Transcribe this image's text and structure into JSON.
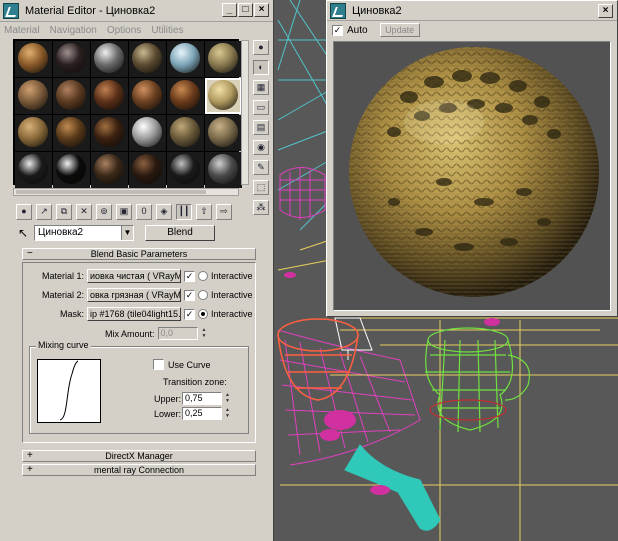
{
  "material_editor": {
    "title": "Material Editor - Циновка2",
    "menu": [
      "Material",
      "Navigation",
      "Options",
      "Utilities"
    ],
    "slots": [
      {
        "color": "#8a5a2a",
        "hi": "#e0b070"
      },
      {
        "color": "#2a2020",
        "hi": "#a09090"
      },
      {
        "color": "#6a6a6a",
        "hi": "#f0f0f0"
      },
      {
        "color": "#5a4a30",
        "hi": "#c8b890"
      },
      {
        "color": "#7ea6b8",
        "hi": "#e8f4fa"
      },
      {
        "color": "#8a7a50",
        "hi": "#d8c890"
      },
      {
        "color": "#7a5a3a",
        "hi": "#d0a070"
      },
      {
        "color": "#5a3a20",
        "hi": "#b08060"
      },
      {
        "color": "#5a3018",
        "hi": "#c08050"
      },
      {
        "color": "#6a4020",
        "hi": "#d09060"
      },
      {
        "color": "#6a3a1a",
        "hi": "#c88a50"
      },
      {
        "color": "#b09a60",
        "hi": "#f0e0a8"
      },
      {
        "color": "#8a6a3a",
        "hi": "#d8b078"
      },
      {
        "color": "#5a3a1a",
        "hi": "#c08a50"
      },
      {
        "color": "#3a2010",
        "hi": "#a07040"
      },
      {
        "color": "#9a9a9a",
        "hi": "#ffffff"
      },
      {
        "color": "#6a5a3a",
        "hi": "#c0a878"
      },
      {
        "color": "#7a6a4a",
        "hi": "#c8b088"
      },
      {
        "color": "#1a1a1a",
        "hi": "#e8e8e8"
      },
      {
        "color": "#0a0a0a",
        "hi": "#f0f0f0"
      },
      {
        "color": "#3a2818",
        "hi": "#a88060"
      },
      {
        "color": "#2a1a10",
        "hi": "#8a6040"
      },
      {
        "color": "#1a1a1a",
        "hi": "#c0c0c0"
      },
      {
        "color": "#4a4a4a",
        "hi": "#d0d0d0"
      }
    ],
    "material_name": "Циновка2",
    "material_type": "Blend",
    "rollout_title": "Blend Basic Parameters",
    "material1_label": "Material 1:",
    "material1_value": "иовка чистая  ( VRayMtl )",
    "material2_label": "Material 2:",
    "material2_value": "овка грязная  ( VRayMtl )",
    "mask_label": "Mask:",
    "mask_value": "ip #1768 (tile04light15.jpg)",
    "interactive_label": "Interactive",
    "mix_amount_label": "Mix Amount:",
    "mix_amount_value": "0,0",
    "mixing_curve_label": "Mixing curve",
    "use_curve_label": "Use Curve",
    "transition_zone_label": "Transition zone:",
    "upper_label": "Upper:",
    "upper_value": "0,75",
    "lower_label": "Lower:",
    "lower_value": "0,25",
    "rollout2_title": "DirectX Manager",
    "rollout3_title": "mental ray Connection"
  },
  "preview": {
    "title": "Циновка2",
    "auto_label": "Auto",
    "update_label": "Update"
  },
  "icons": [
    "app-icon",
    "minimize-icon",
    "maximize-icon",
    "close-icon",
    "picker-icon",
    "sphere-icon",
    "checker-icon"
  ]
}
